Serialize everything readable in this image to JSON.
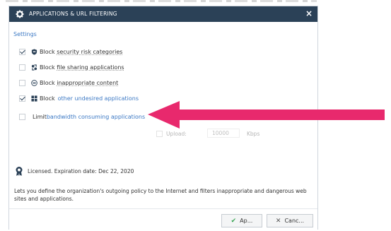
{
  "dialog": {
    "title": "APPLICATIONS & URL FILTERING",
    "close_symbol": "×"
  },
  "settings_label": "Settings",
  "options": {
    "security": {
      "checked": true,
      "prefix": "Block ",
      "text": "security risk categories",
      "icon": "shield-icon"
    },
    "filesharing": {
      "checked": false,
      "prefix": "Block ",
      "text": "file sharing applications",
      "icon": "file-sharing-icon"
    },
    "inappropriate": {
      "checked": false,
      "prefix": "Block ",
      "text": "inappropriate content",
      "icon": "18plus-icon"
    },
    "other": {
      "checked": true,
      "prefix": "Block",
      "link": "other undesired applications",
      "icon": "windows-apps-icon"
    },
    "bandwidth": {
      "checked": false,
      "prefix": "Limit ",
      "link": "bandwidth consuming applications"
    }
  },
  "upload": {
    "label": "Upload:",
    "value": "10000",
    "unit": "Kbps"
  },
  "license_text": "Licensed. Expiration date: Dec 22, 2020",
  "description": "Lets you define the organization's outgoing policy to the Internet and filters inappropriate and dangerous web sites and applications.",
  "buttons": {
    "ok": "Ap...",
    "cancel": "Canc..."
  },
  "colors": {
    "titlebar": "#2b4157",
    "link": "#3b78c4",
    "arrow": "#e8296d"
  }
}
